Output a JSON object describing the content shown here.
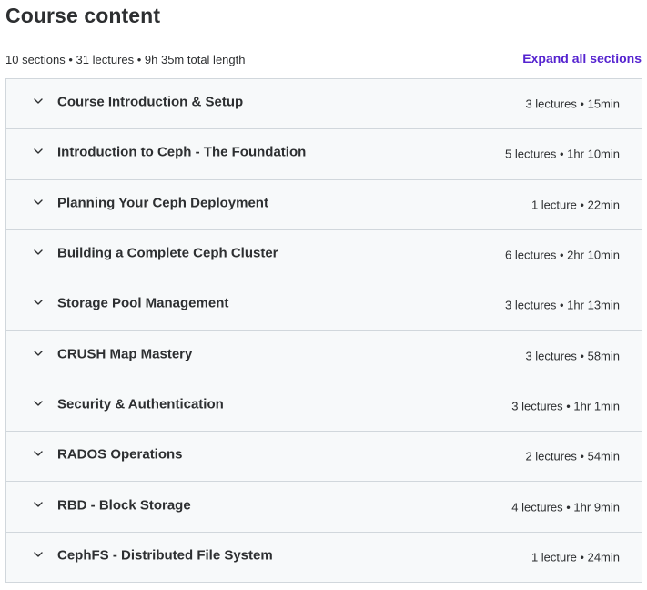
{
  "header": {
    "title": "Course content",
    "summary": "10 sections • 31 lectures • 9h 35m total length",
    "expand_label": "Expand all sections"
  },
  "icons": {
    "chevron": "chevron-down-icon"
  },
  "colors": {
    "accent": "#5624d0",
    "section_bg": "#f7f9fa",
    "border": "#d1d7dc",
    "text": "#2d2f31"
  },
  "sections": [
    {
      "title": "Course Introduction & Setup",
      "info": "3 lectures • 15min"
    },
    {
      "title": "Introduction to Ceph - The Foundation",
      "info": "5 lectures • 1hr 10min"
    },
    {
      "title": "Planning Your Ceph Deployment",
      "info": "1 lecture • 22min"
    },
    {
      "title": "Building a Complete Ceph Cluster",
      "info": "6 lectures • 2hr 10min"
    },
    {
      "title": "Storage Pool Management",
      "info": "3 lectures • 1hr 13min"
    },
    {
      "title": "CRUSH Map Mastery",
      "info": "3 lectures • 58min"
    },
    {
      "title": "Security & Authentication",
      "info": "3 lectures • 1hr 1min"
    },
    {
      "title": "RADOS Operations",
      "info": "2 lectures • 54min"
    },
    {
      "title": "RBD - Block Storage",
      "info": "4 lectures • 1hr 9min"
    },
    {
      "title": "CephFS - Distributed File System",
      "info": "1 lecture • 24min"
    }
  ]
}
